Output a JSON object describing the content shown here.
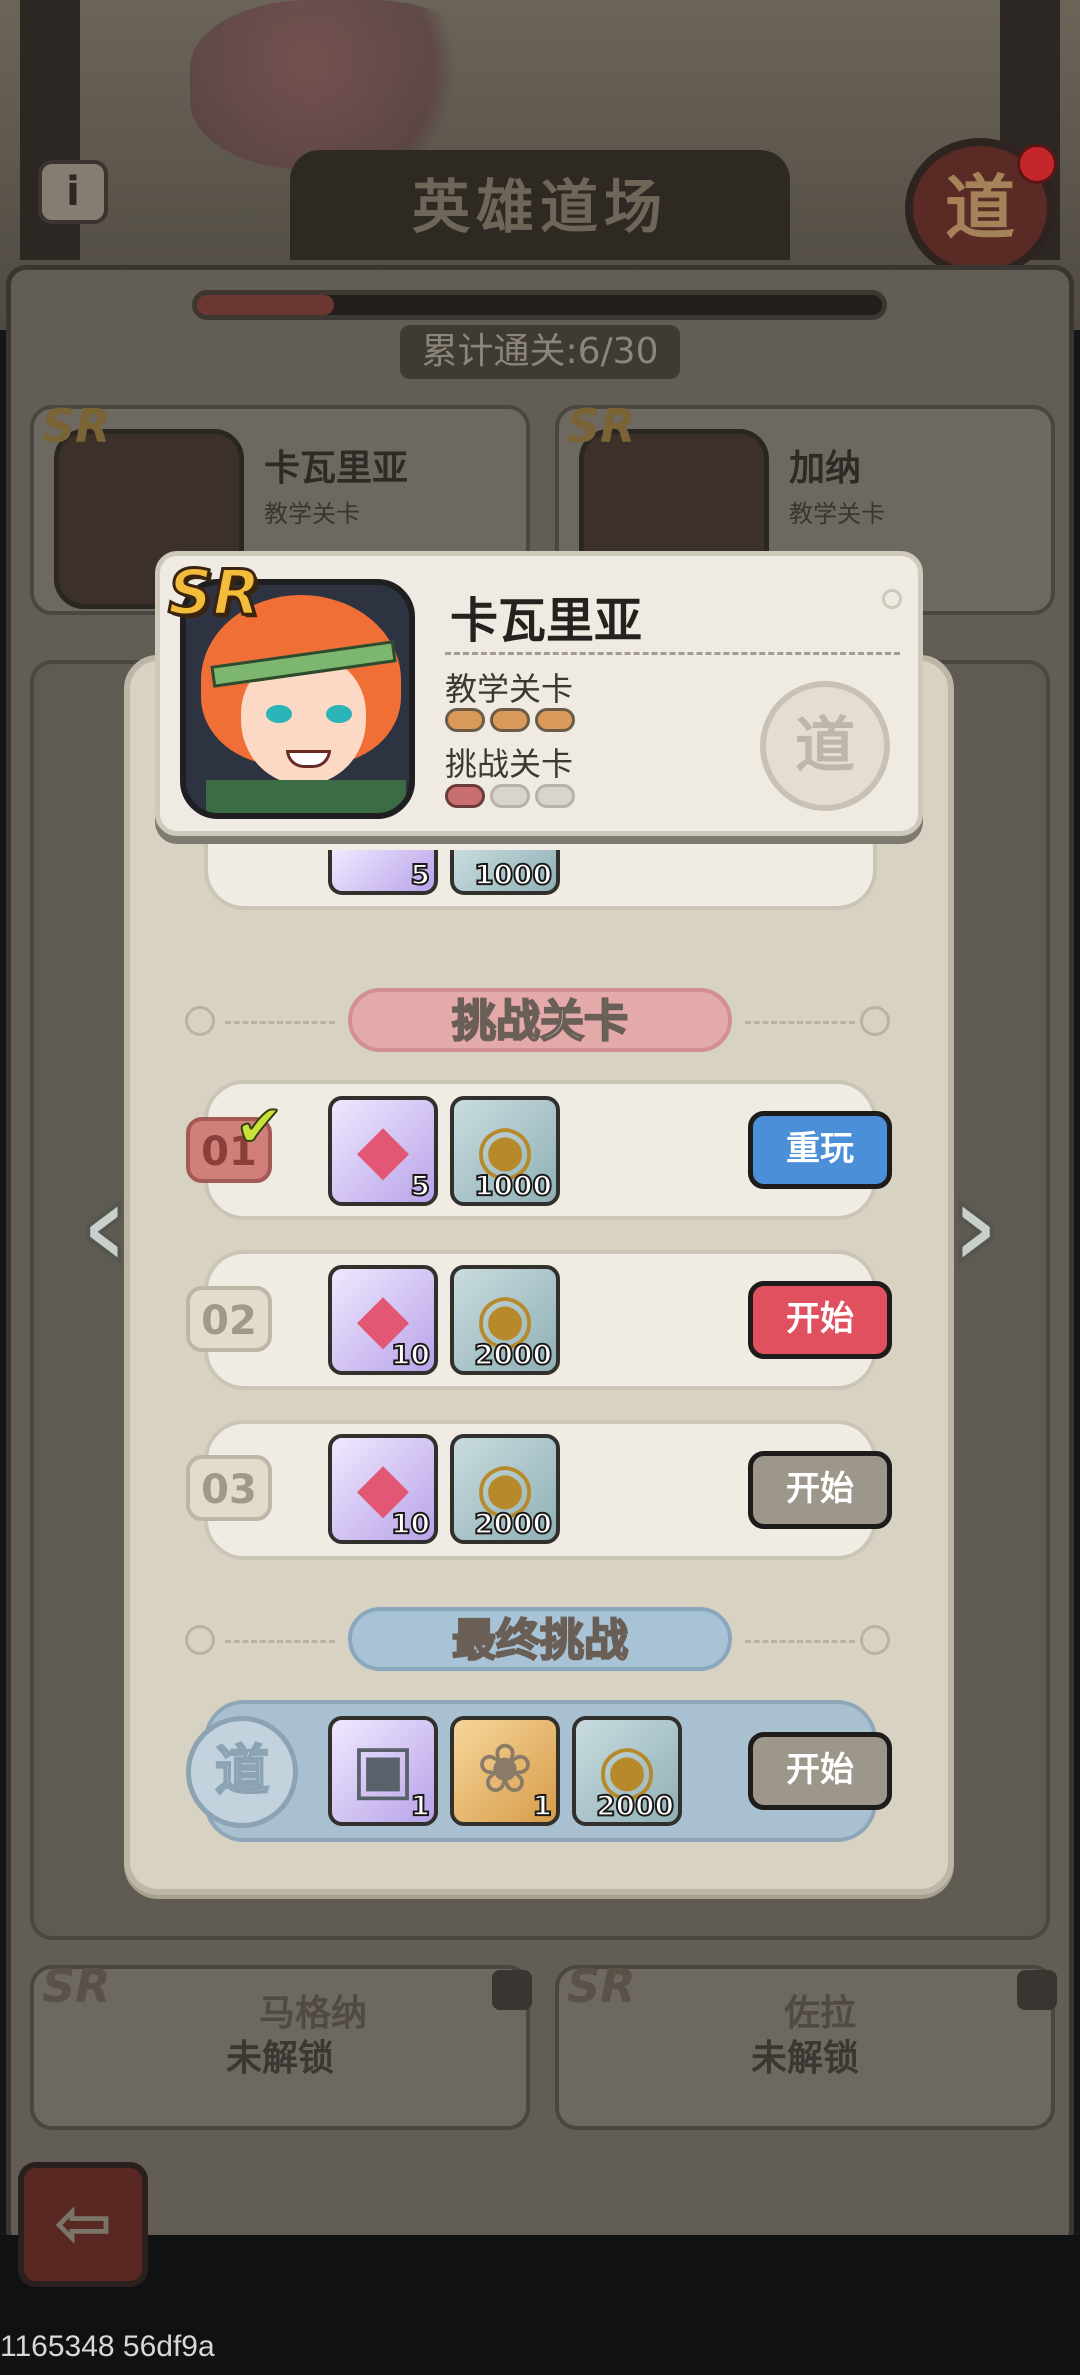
{
  "screen": {
    "title": "英雄道场",
    "progress_text": "累计通关:6/30",
    "progress_fraction": 0.2,
    "seal_char": "道",
    "info_icon_char": "i"
  },
  "background_cards": [
    {
      "name": "卡瓦里亚",
      "sub": "教学关卡",
      "rarity": "SR"
    },
    {
      "name": "加纳",
      "sub": "教学关卡",
      "rarity": "SR"
    }
  ],
  "locked_cards": [
    {
      "name": "马格纳",
      "status": "未解锁",
      "rarity": "SR"
    },
    {
      "name": "佐拉",
      "status": "未解锁",
      "rarity": "SR"
    }
  ],
  "hero": {
    "rarity": "SR",
    "name": "卡瓦里亚",
    "tutorial_label": "教学关卡",
    "challenge_label": "挑战关卡",
    "tutorial_progress": 3,
    "tutorial_total": 3,
    "challenge_progress": 1,
    "challenge_total": 3,
    "seal_char": "道"
  },
  "partial_row": {
    "gem_count": "5",
    "coin_count": "1000"
  },
  "challenge_section": {
    "title": "挑战关卡",
    "levels": [
      {
        "num": "01",
        "gem_count": "5",
        "coin_count": "1000",
        "button": "重玩",
        "state": "done"
      },
      {
        "num": "02",
        "gem_count": "10",
        "coin_count": "2000",
        "button": "开始",
        "state": "active"
      },
      {
        "num": "03",
        "gem_count": "10",
        "coin_count": "2000",
        "button": "开始",
        "state": "locked"
      }
    ]
  },
  "final_section": {
    "title": "最终挑战",
    "seal_char": "道",
    "rewards": [
      {
        "icon": "helmet-icon",
        "count": "1"
      },
      {
        "icon": "key-icon",
        "count": "1"
      },
      {
        "icon": "coin-icon",
        "count": "2000"
      }
    ],
    "button": "开始"
  },
  "colors": {
    "replay_button": "#4b8fd8",
    "start_button_active": "#e0505e",
    "start_button_inactive": "#9d968a",
    "challenge_header": "#e4a9a9",
    "final_header": "#a8c3d6"
  },
  "watermark": "1165348 56df9a"
}
